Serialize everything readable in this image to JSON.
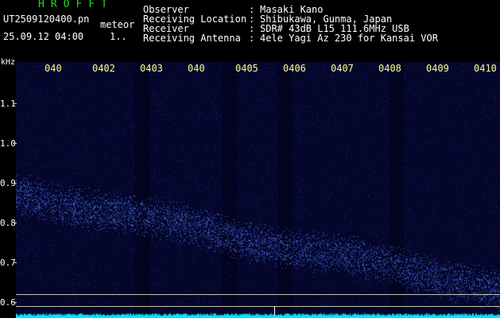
{
  "header": {
    "app_title": "HROFFT",
    "filename": "UT2509120400.pn",
    "mode": "meteor",
    "datetime": "25.09.12 04:00",
    "frame_indicator": "1..",
    "info": [
      {
        "label": "Observer",
        "value": "Masaki Kano"
      },
      {
        "label": "Receiving Location",
        "value": "Shibukawa, Gunma, Japan"
      },
      {
        "label": "Receiver",
        "value": "SDR# 43dB L15 111.6MHz USB"
      },
      {
        "label": "Receiving Antenna",
        "value": "4ele Yagi Az 230 for Kansai VOR"
      }
    ],
    "separator": ":"
  },
  "plot": {
    "unit_label": "kHz",
    "time_ticks": [
      "040",
      "0402",
      "0403",
      "040",
      "0405",
      "0406",
      "0407",
      "0408",
      "0409",
      "0410"
    ],
    "freq_ticks": [
      "1.1",
      "1.0",
      "0.9",
      "0.8",
      "0.7",
      "0.6"
    ],
    "colors": {
      "background": "#04062a",
      "signal": "#4a6cff",
      "noise_floor": "#00e5ff"
    }
  }
}
